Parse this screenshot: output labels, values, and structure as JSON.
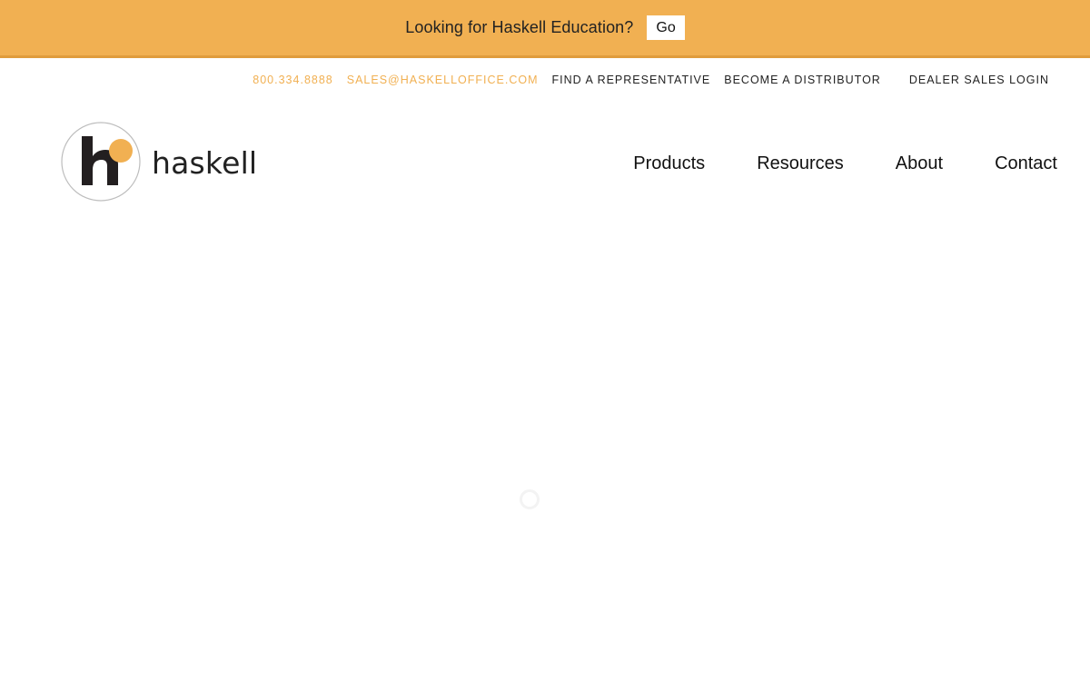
{
  "promo": {
    "text": "Looking for Haskell Education?",
    "button": "Go"
  },
  "utility": {
    "phone": "800.334.8888",
    "email": "SALES@HASKELLOFFICE.COM",
    "find_rep": "FIND A REPRESENTATIVE",
    "distributor": "BECOME A DISTRIBUTOR",
    "dealer_login": "DEALER SALES LOGIN"
  },
  "logo": {
    "wordmark": "haskell",
    "mark_letter": "h"
  },
  "nav": {
    "products": "Products",
    "resources": "Resources",
    "about": "About",
    "contact": "Contact"
  },
  "colors": {
    "accent": "#f1b052",
    "text_dark": "#222222"
  },
  "icons": {
    "logo": "haskell-logo-icon",
    "loader": "loading-spinner-icon"
  }
}
